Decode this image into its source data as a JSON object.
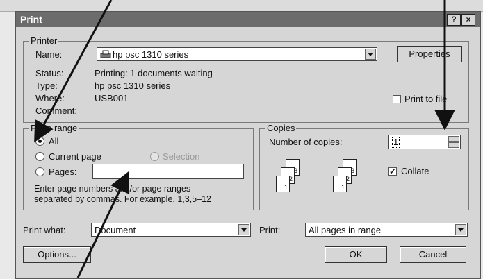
{
  "dialog": {
    "title": "Print"
  },
  "printer": {
    "group_label": "Printer",
    "name_label": "Name:",
    "name_value": "hp psc 1310 series",
    "properties_button": "Properties",
    "status_label": "Status:",
    "status_value": "Printing: 1 documents waiting",
    "type_label": "Type:",
    "type_value": "hp psc 1310 series",
    "where_label": "Where:",
    "where_value": "USB001",
    "comment_label": "Comment:",
    "print_to_file_label": "Print to file"
  },
  "page_range": {
    "group_label": "Page range",
    "all_label": "All",
    "current_page_label": "Current page",
    "selection_label": "Selection",
    "pages_label": "Pages:",
    "pages_value": "",
    "help_line1": "Enter page numbers and/or page ranges",
    "help_line2": "separated by commas.  For example, 1,3,5–12"
  },
  "copies": {
    "group_label": "Copies",
    "number_label": "Number of copies:",
    "number_value": "1",
    "collate_label": "Collate",
    "collate_checked": true
  },
  "footer": {
    "print_what_label": "Print what:",
    "print_what_value": "Document",
    "print_label": "Print:",
    "print_value": "All pages in range",
    "options_button": "Options...",
    "ok_button": "OK",
    "cancel_button": "Cancel"
  },
  "icons": {
    "printer": "printer-icon",
    "help": "help-icon",
    "close": "close-icon"
  },
  "colors": {
    "dialog_bg": "#d6d6d6",
    "titlebar": "#6c6c6c",
    "annotation": "#111111"
  }
}
